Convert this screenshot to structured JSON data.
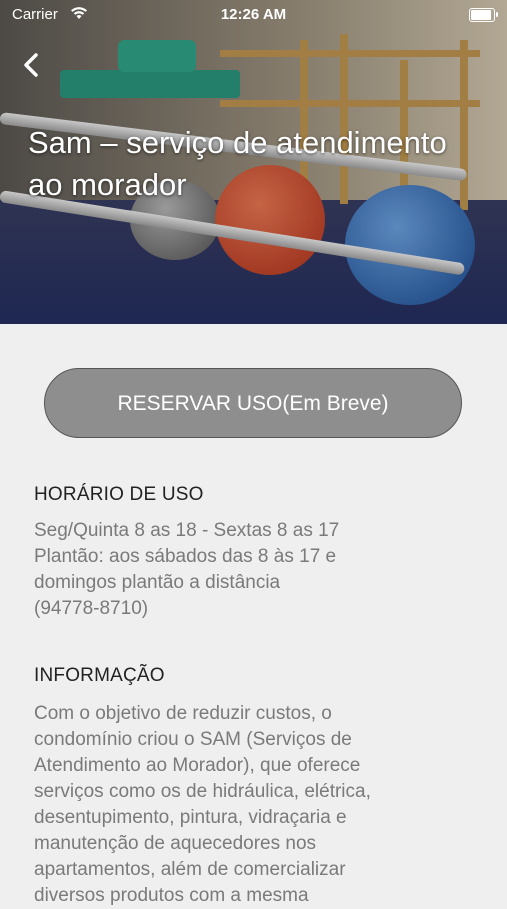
{
  "status_bar": {
    "carrier": "Carrier",
    "time": "12:26 AM"
  },
  "header": {
    "back_icon": "chevron-left-icon",
    "title": "Sam – serviço de atendimento ao morador"
  },
  "reserve_button": {
    "label": "RESERVAR USO(Em Breve)"
  },
  "schedule": {
    "heading": "HORÁRIO DE USO",
    "lines": [
      "Seg/Quinta 8 as 18 - Sextas 8 as 17",
      "Plantão: aos sábados das 8 às 17 e",
      "domingos plantão a distância",
      "(94778-8710)"
    ]
  },
  "info": {
    "heading": "INFORMAÇÃO",
    "lines": [
      "Com o objetivo de reduzir custos, o",
      "condomínio criou o SAM (Serviços de",
      "Atendimento ao Morador), que oferece",
      "serviços como os de hidráulica, elétrica,",
      "desentupimento, pintura, vidraçaria e",
      "manutenção de aquecedores nos",
      "apartamentos, além de comercializar",
      "diversos produtos com a mesma"
    ]
  },
  "colors": {
    "button_bg": "#8e8e8e",
    "background": "#efefef",
    "body_text": "#7a7a7a"
  }
}
